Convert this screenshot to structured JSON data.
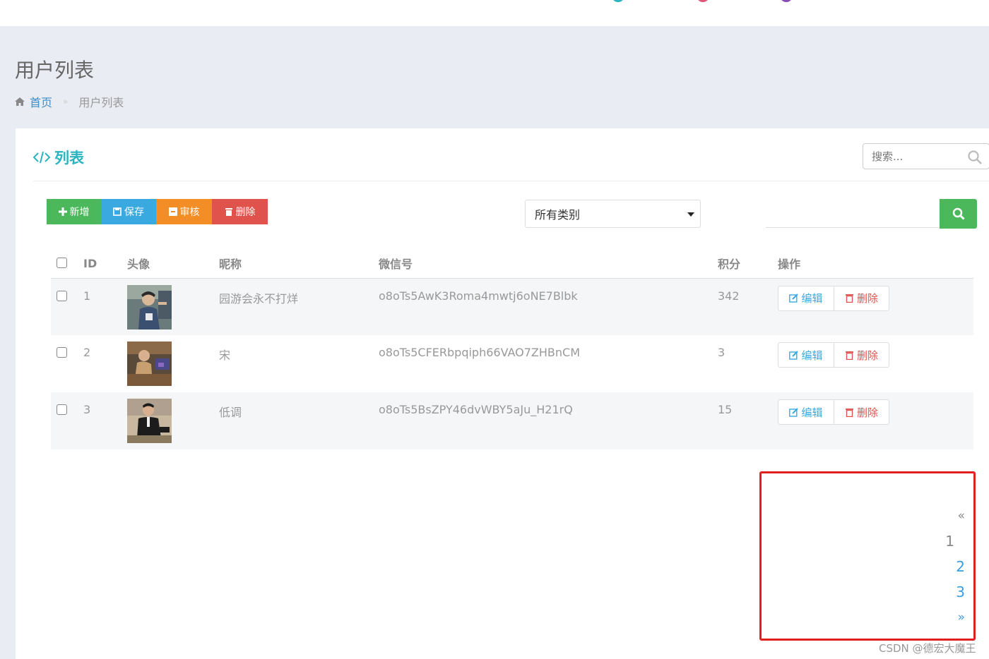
{
  "page": {
    "title": "用户列表"
  },
  "breadcrumb": {
    "home": "首页",
    "sep": "»",
    "current": "用户列表"
  },
  "panel": {
    "title": "列表",
    "search_placeholder": "搜索..."
  },
  "toolbar": {
    "add": "新增",
    "save": "保存",
    "audit": "审核",
    "delete": "删除"
  },
  "filter": {
    "category": "所有类别",
    "keyword": ""
  },
  "table": {
    "headers": {
      "id": "ID",
      "avatar": "头像",
      "nickname": "昵称",
      "wechat": "微信号",
      "points": "积分",
      "actions": "操作"
    },
    "rows": [
      {
        "id": "1",
        "nickname": "园游会永不打烊",
        "wechat": "o8oTs5AwK3Roma4mwtj6oNE7Blbk",
        "points": "342",
        "edit": "编辑",
        "delete": "删除"
      },
      {
        "id": "2",
        "nickname": "宋",
        "wechat": "o8oTs5CFERbpqiph66VAO7ZHBnCM",
        "points": "3",
        "edit": "编辑",
        "delete": "删除"
      },
      {
        "id": "3",
        "nickname": "低调",
        "wechat": "o8oTs5BsZPY46dvWBY5aJu_H21rQ",
        "points": "15",
        "edit": "编辑",
        "delete": "删除"
      }
    ]
  },
  "pagination": {
    "prev": "«",
    "pages": [
      "1",
      "2",
      "3"
    ],
    "current": "1",
    "next": "»"
  },
  "watermark": "CSDN @德宏大魔王",
  "colors": {
    "accent": "#2ab4c0",
    "success": "#4cb85c",
    "info": "#3aa9e0",
    "warning": "#f38d26",
    "danger": "#e0534d",
    "highlight_frame": "#e02020"
  },
  "icons": {
    "home": "home-icon",
    "code": "code-icon",
    "search": "search-icon",
    "plus": "plus-icon",
    "save": "save-icon",
    "audit": "audit-icon",
    "trash": "trash-icon",
    "edit": "edit-icon"
  }
}
